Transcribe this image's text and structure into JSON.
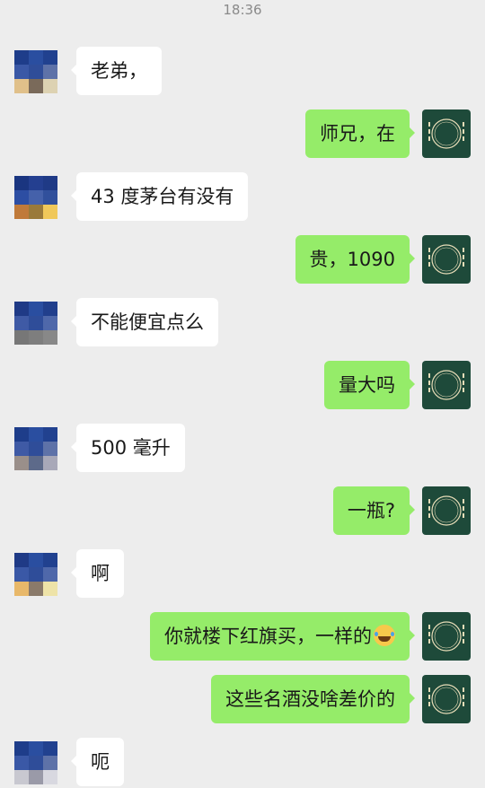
{
  "status": {
    "time": "18:36"
  },
  "messages": [
    {
      "id": "m1",
      "sender": "contact",
      "text": "老弟，"
    },
    {
      "id": "m2",
      "sender": "self",
      "text": "师兄，在"
    },
    {
      "id": "m3",
      "sender": "contact",
      "text": "43 度茅台有没有"
    },
    {
      "id": "m4",
      "sender": "self",
      "text": "贵，1090"
    },
    {
      "id": "m5",
      "sender": "contact",
      "text": "不能便宜点么"
    },
    {
      "id": "m6",
      "sender": "self",
      "text": "量大吗"
    },
    {
      "id": "m7",
      "sender": "contact",
      "text": "500 毫升"
    },
    {
      "id": "m8",
      "sender": "self",
      "text": "一瓶?"
    },
    {
      "id": "m9",
      "sender": "contact",
      "text": "啊"
    },
    {
      "id": "m10",
      "sender": "self",
      "text": "你就楼下红旗买，一样的",
      "emoji": "face-with-tears-of-joy"
    },
    {
      "id": "m11",
      "sender": "self",
      "text": "这些名酒没啥差价的"
    },
    {
      "id": "m12",
      "sender": "contact",
      "text": "呃"
    }
  ],
  "self_avatar": {
    "logo_text": "鹿港轩",
    "color": "#1e4a3a"
  },
  "colors": {
    "background": "#ededed",
    "incoming_bubble": "#ffffff",
    "outgoing_bubble": "#95ec69",
    "text": "#191919"
  }
}
